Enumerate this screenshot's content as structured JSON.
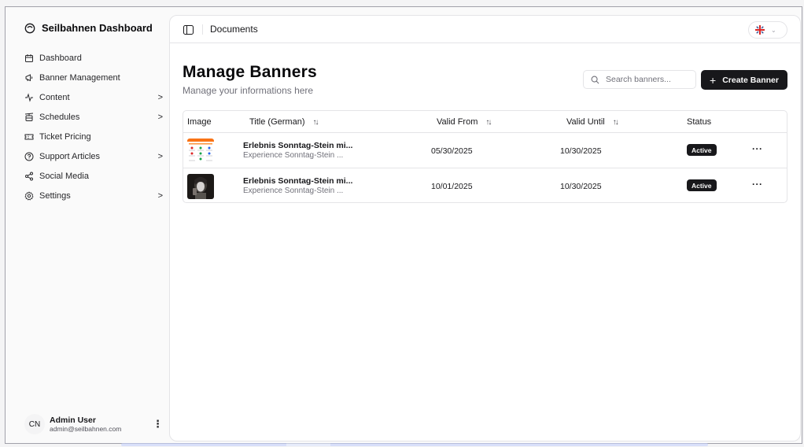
{
  "sidebar": {
    "brand": "Seilbahnen Dashboard",
    "items": [
      {
        "label": "Dashboard",
        "icon": "calendar-icon",
        "chevron": false
      },
      {
        "label": "Banner Management",
        "icon": "megaphone-icon",
        "chevron": false
      },
      {
        "label": "Content",
        "icon": "activity-icon",
        "chevron": true
      },
      {
        "label": "Schedules",
        "icon": "cable-car-icon",
        "chevron": true
      },
      {
        "label": "Ticket Pricing",
        "icon": "ticket-icon",
        "chevron": false
      },
      {
        "label": "Support Articles",
        "icon": "help-circle-icon",
        "chevron": true
      },
      {
        "label": "Social Media",
        "icon": "share-icon",
        "chevron": false
      },
      {
        "label": "Settings",
        "icon": "gear-icon",
        "chevron": true
      }
    ],
    "chevron_glyph": ">",
    "user": {
      "initials": "CN",
      "name": "Admin User",
      "email": "admin@seilbahnen.com",
      "menu_glyph": "⋮"
    }
  },
  "topbar": {
    "title": "Documents",
    "language_chevron": "⌄"
  },
  "page": {
    "title": "Manage Banners",
    "subtitle": "Manage your informations here",
    "search_placeholder": "Search banners...",
    "create_label": "Create Banner",
    "create_plus": "+"
  },
  "table": {
    "headers": {
      "image": "Image",
      "title": "Title (German)",
      "valid_from": "Valid From",
      "valid_until": "Valid Until",
      "status": "Status"
    },
    "sort_glyph": "↑↓",
    "rows": [
      {
        "title": "Erlebnis Sonntag-Stein mi...",
        "subtitle": "Experience Sonntag-Stein ...",
        "valid_from": "05/30/2025",
        "valid_until": "10/30/2025",
        "status": "Active",
        "more": "···",
        "thumbnail": "info-poster"
      },
      {
        "title": "Erlebnis Sonntag-Stein mi...",
        "subtitle": "Experience Sonntag-Stein ...",
        "valid_from": "10/01/2025",
        "valid_until": "10/30/2025",
        "status": "Active",
        "more": "···",
        "thumbnail": "photo-portrait"
      }
    ]
  },
  "colors": {
    "primary": "#18181b",
    "muted_text": "#71717a",
    "border": "#e4e4e7",
    "background": "#fafafa"
  }
}
